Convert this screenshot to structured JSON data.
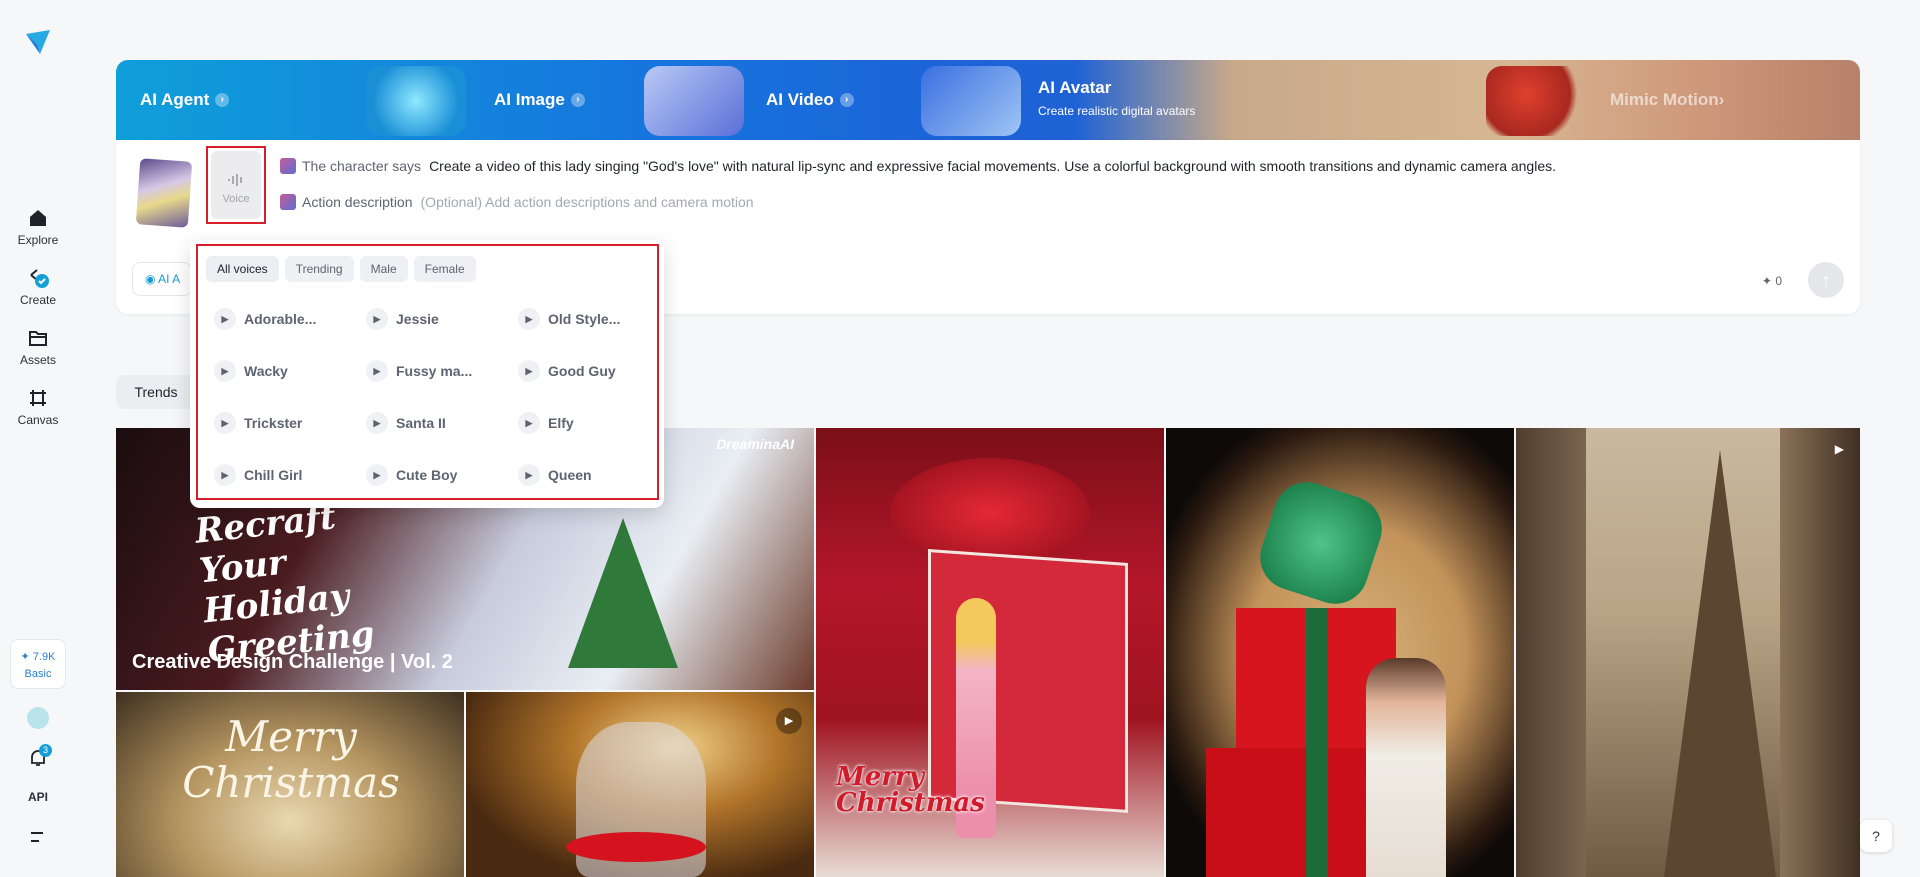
{
  "sidebar": {
    "nav": [
      {
        "label": "Explore",
        "icon": "home-icon"
      },
      {
        "label": "Create",
        "icon": "create-icon"
      },
      {
        "label": "Assets",
        "icon": "folder-icon"
      },
      {
        "label": "Canvas",
        "icon": "canvas-icon"
      }
    ],
    "credits": {
      "value": "7.9K",
      "plan": "Basic"
    },
    "notifications_count": "3",
    "api_label": "API"
  },
  "banner": {
    "tabs": [
      {
        "label": "AI Agent"
      },
      {
        "label": "AI Image"
      },
      {
        "label": "AI Video"
      }
    ],
    "avatar": {
      "title": "AI Avatar",
      "subtitle": "Create realistic digital avatars"
    },
    "mimic": {
      "label": "Mimic Motion"
    }
  },
  "prompt": {
    "voice_label": "Voice",
    "character_label": "The character says",
    "character_text": "Create a video of this lady singing \"God's love\" with natural lip-sync and expressive facial movements. Use a colorful background with smooth transitions and dynamic camera angles.",
    "action_label": "Action description",
    "action_placeholder": "(Optional) Add action descriptions and camera motion",
    "ai_chip_label": "AI A",
    "credit_cost": "0"
  },
  "trends_tab": "Trends",
  "gallery": {
    "featured_title": "Creative Design Challenge | Vol. 2",
    "featured_art_text": "Recraft Your Holiday Greeting",
    "brand": "DreaminaAI",
    "merry_text_1": "Merry Christmas",
    "merry_text_2": "Merry Christmas"
  },
  "voice_menu": {
    "filters": [
      "All voices",
      "Trending",
      "Male",
      "Female"
    ],
    "voices": [
      [
        "Adorable...",
        "Jessie",
        "Old Style..."
      ],
      [
        "Wacky",
        "Fussy ma...",
        "Good Guy"
      ],
      [
        "Trickster",
        "Santa II",
        "Elfy"
      ],
      [
        "Chill Girl",
        "Cute Boy",
        "Queen"
      ]
    ]
  },
  "colors": {
    "accent": "#14a0d6",
    "highlight": "#d71f2a"
  }
}
